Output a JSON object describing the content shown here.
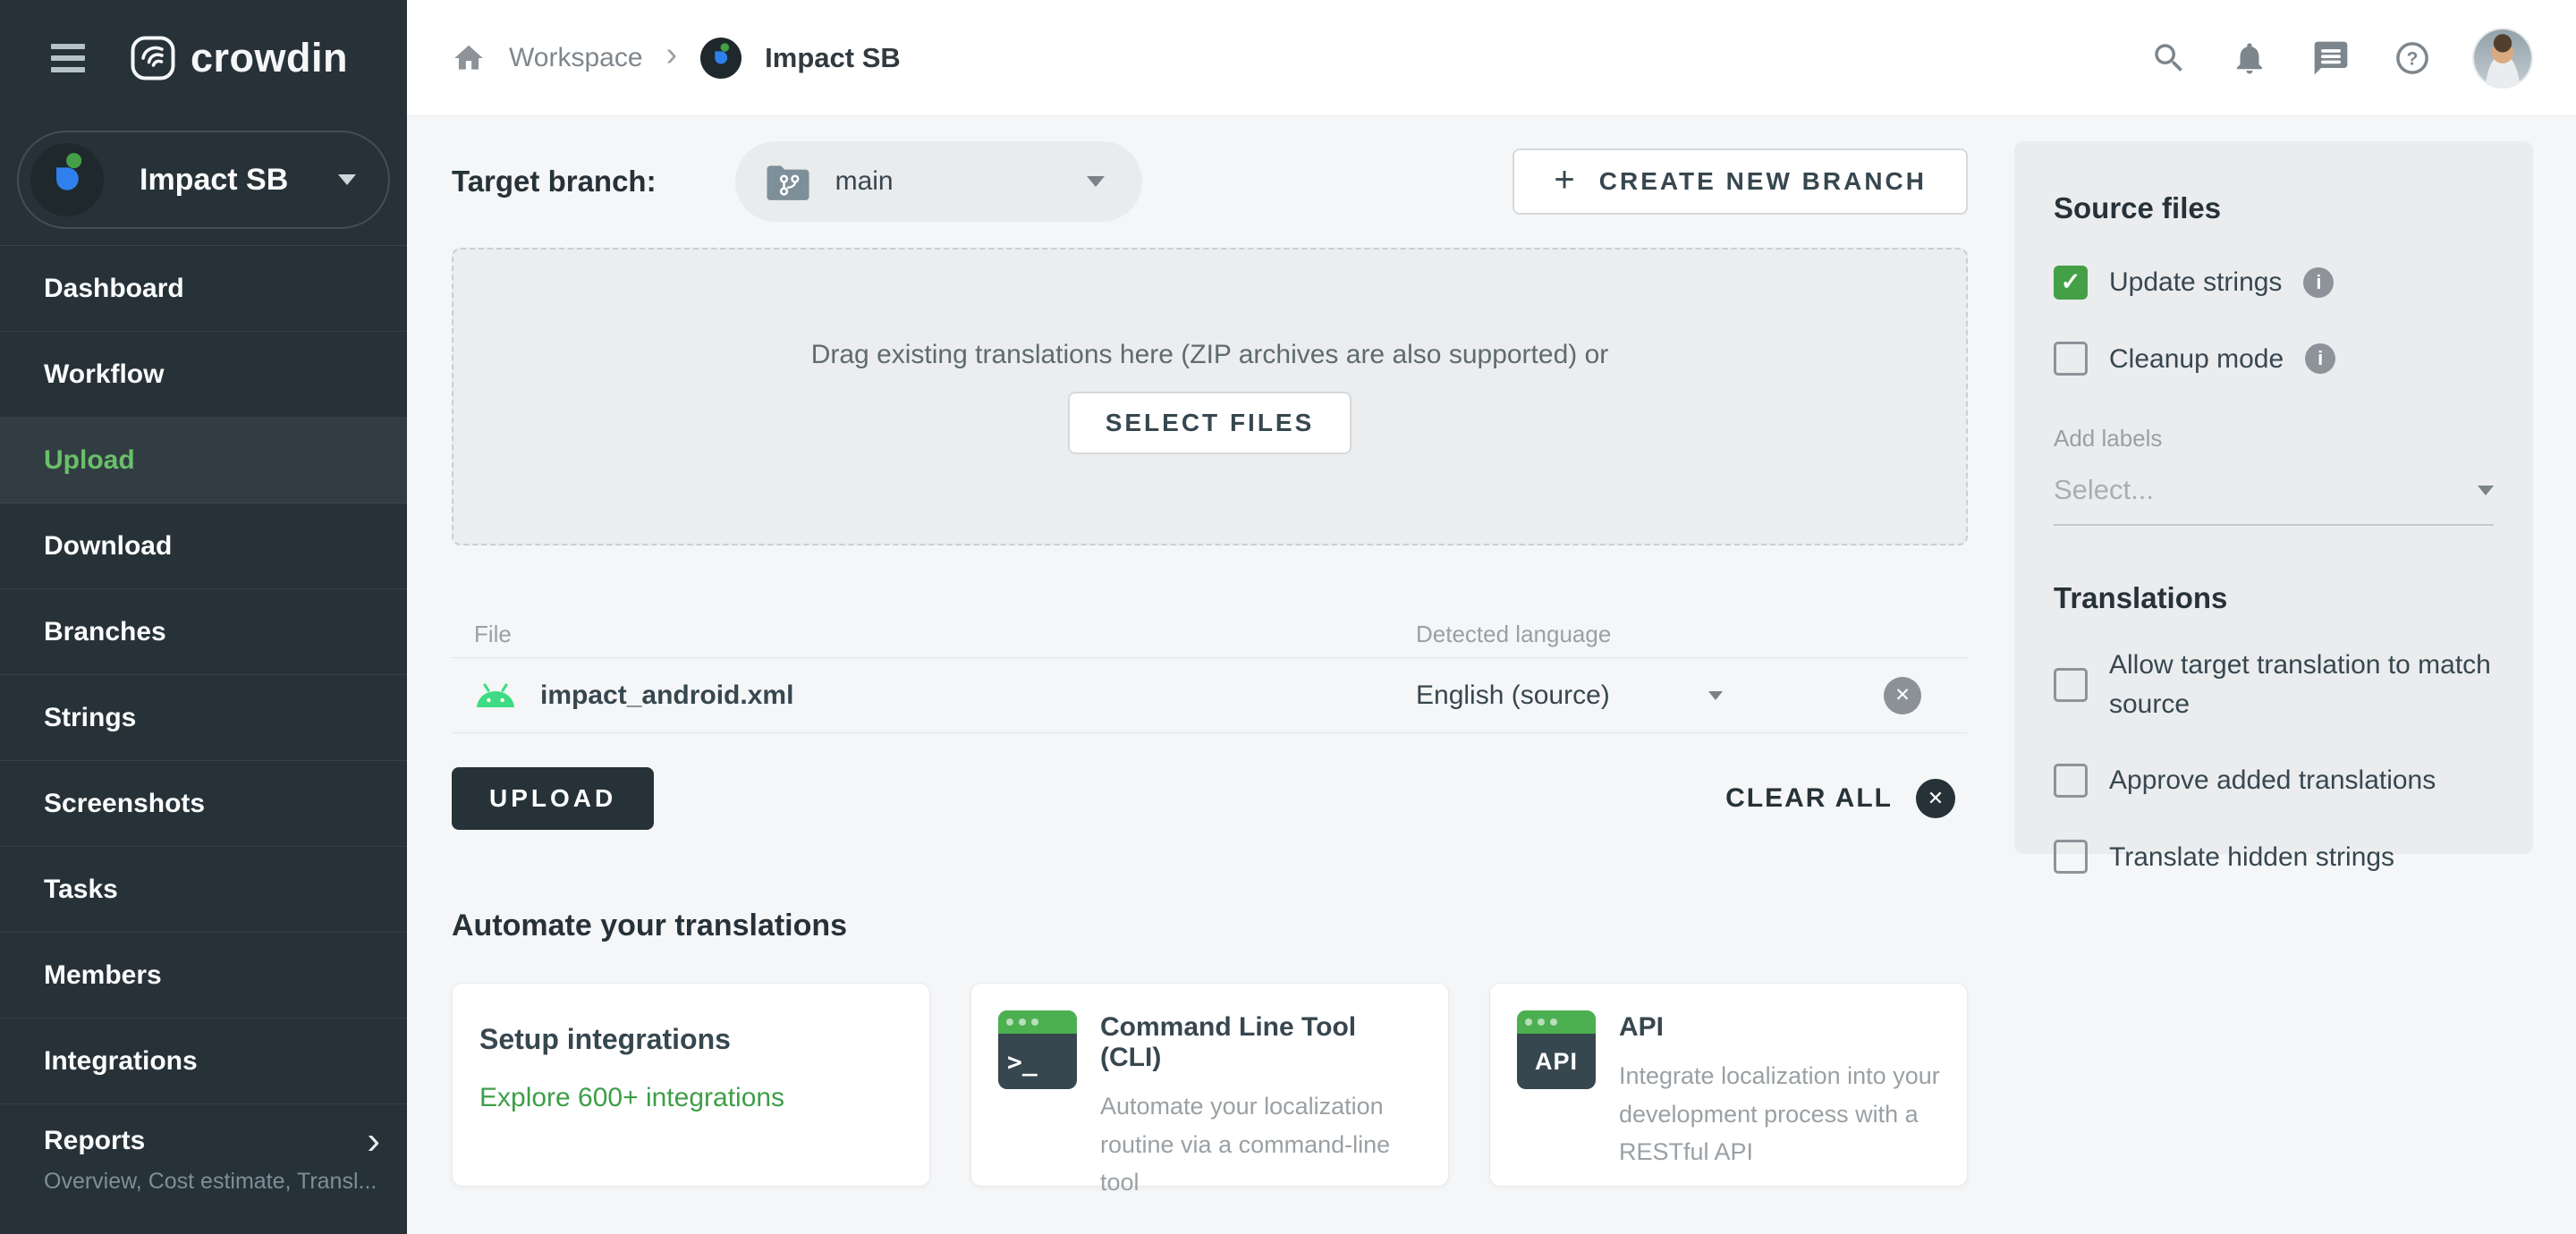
{
  "app": {
    "name": "crowdin"
  },
  "glyphs": {
    "caret_down": "▾",
    "chevron_right": "›",
    "close": "✕",
    "question": "?",
    "info": "i",
    "check": "✓",
    "plus": "+"
  },
  "topbar": {
    "breadcrumb": {
      "workspace": "Workspace",
      "project": "Impact SB"
    }
  },
  "sidebar": {
    "project_name": "Impact SB",
    "items": [
      {
        "label": "Dashboard"
      },
      {
        "label": "Workflow"
      },
      {
        "label": "Upload",
        "selected": true
      },
      {
        "label": "Download"
      },
      {
        "label": "Branches"
      },
      {
        "label": "Strings"
      },
      {
        "label": "Screenshots"
      },
      {
        "label": "Tasks"
      },
      {
        "label": "Members"
      },
      {
        "label": "Integrations"
      },
      {
        "label": "Reports",
        "sublabel": "Overview, Cost estimate, Transl...",
        "has_submenu": true
      }
    ]
  },
  "main": {
    "target_branch_label": "Target branch:",
    "branch": {
      "value": "main"
    },
    "create_branch_button": "CREATE NEW BRANCH",
    "dropzone": {
      "hint": "Drag existing translations here (ZIP archives are also supported) or",
      "button": "SELECT FILES"
    },
    "files": {
      "columns": {
        "file": "File",
        "language": "Detected language"
      },
      "rows": [
        {
          "name": "impact_android.xml",
          "language": "English (source)"
        }
      ]
    },
    "upload_button": "UPLOAD",
    "clear_all_button": "CLEAR ALL",
    "automate": {
      "heading": "Automate your translations",
      "cards": [
        {
          "title": "Setup integrations",
          "link": "Explore 600+ integrations"
        },
        {
          "title": "Command Line Tool (CLI)",
          "icon_text": ">_",
          "description": "Automate your localization routine via a command-line tool"
        },
        {
          "title": "API",
          "icon_text": "API",
          "description": "Integrate localization into your development process with a RESTful API"
        }
      ]
    }
  },
  "panel": {
    "source_files": {
      "title": "Source files",
      "options": [
        {
          "label": "Update strings",
          "checked": true,
          "has_info": true
        },
        {
          "label": "Cleanup mode",
          "checked": false,
          "has_info": true
        }
      ],
      "add_labels": "Add labels",
      "labels_placeholder": "Select..."
    },
    "translations": {
      "title": "Translations",
      "options": [
        {
          "label": "Allow target translation to match source",
          "checked": false
        },
        {
          "label": "Approve added translations",
          "checked": false
        },
        {
          "label": "Translate hidden strings",
          "checked": false
        }
      ]
    }
  },
  "colors": {
    "sidebar_bg": "#263238",
    "accent_green": "#43a047",
    "nav_selected_green": "#6abf69",
    "link_green": "#3e9e47",
    "page_bg": "#f5f6f7",
    "panel_bg": "#eaecee",
    "dark_button": "#263238",
    "android_green": "#3ddc84"
  }
}
